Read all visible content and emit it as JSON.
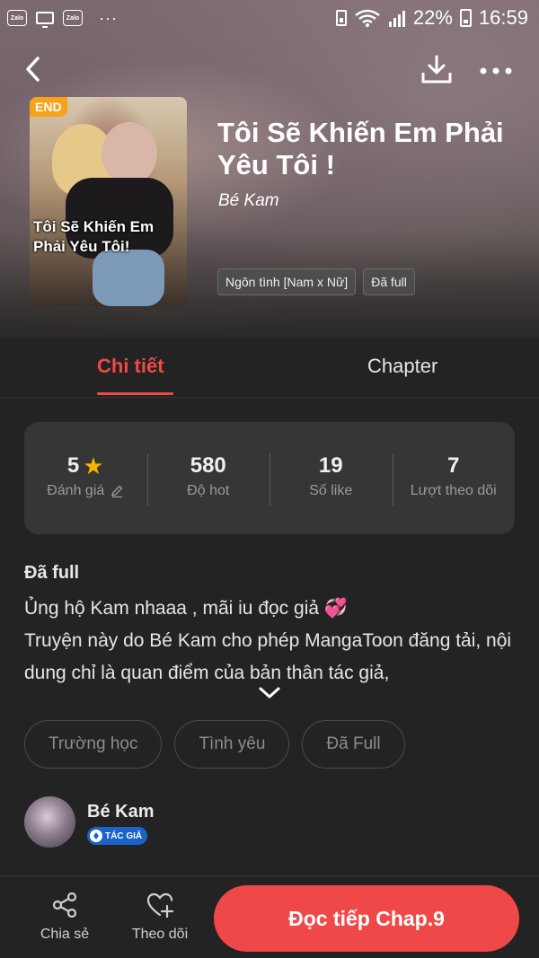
{
  "status_bar": {
    "left_icons": [
      "zalo-icon",
      "screen-cast-icon",
      "zalo-icon"
    ],
    "battery_text": "22%",
    "time": "16:59",
    "zalo_label": "Zalo",
    "dots": "···"
  },
  "book": {
    "badge": "END",
    "cover_title": "Tôi Sẽ Khiến Em Phải Yêu Tôi!",
    "title": "Tôi Sẽ Khiến Em Phải Yêu Tôi !",
    "author": "Bé Kam",
    "genre_tags": [
      "Ngôn tình [Nam x Nữ]",
      "Đã full"
    ]
  },
  "tabs": {
    "detail": "Chi tiết",
    "chapter": "Chapter",
    "active": "detail"
  },
  "stats": {
    "rating": {
      "value": "5",
      "label": "Đánh giá"
    },
    "hot": {
      "value": "580",
      "label": "Độ hot"
    },
    "likes": {
      "value": "19",
      "label": "Số like"
    },
    "followers": {
      "value": "7",
      "label": "Lượt theo dõi"
    }
  },
  "description": {
    "status": "Đã full",
    "line1": "Ủng hộ Kam nhaaa , mãi iu đọc giả",
    "emoji": "💞",
    "line2": "Truyện này do Bé Kam cho phép MangaToon đăng tải, nội dung chỉ là quan điểm của bản thân tác giả,"
  },
  "topic_tags": [
    "Trường học",
    "Tình yêu",
    "Đã Full"
  ],
  "author_card": {
    "name": "Bé Kam",
    "badge": "TÁC GIẢ"
  },
  "bottom_bar": {
    "share": "Chia sẻ",
    "follow": "Theo dõi",
    "read": "Đọc tiếp Chap.9"
  },
  "colors": {
    "accent": "#f04848",
    "end_badge": "#f7a21b",
    "author_badge": "#1c63c9",
    "star": "#f7b500",
    "background": "#232323"
  }
}
